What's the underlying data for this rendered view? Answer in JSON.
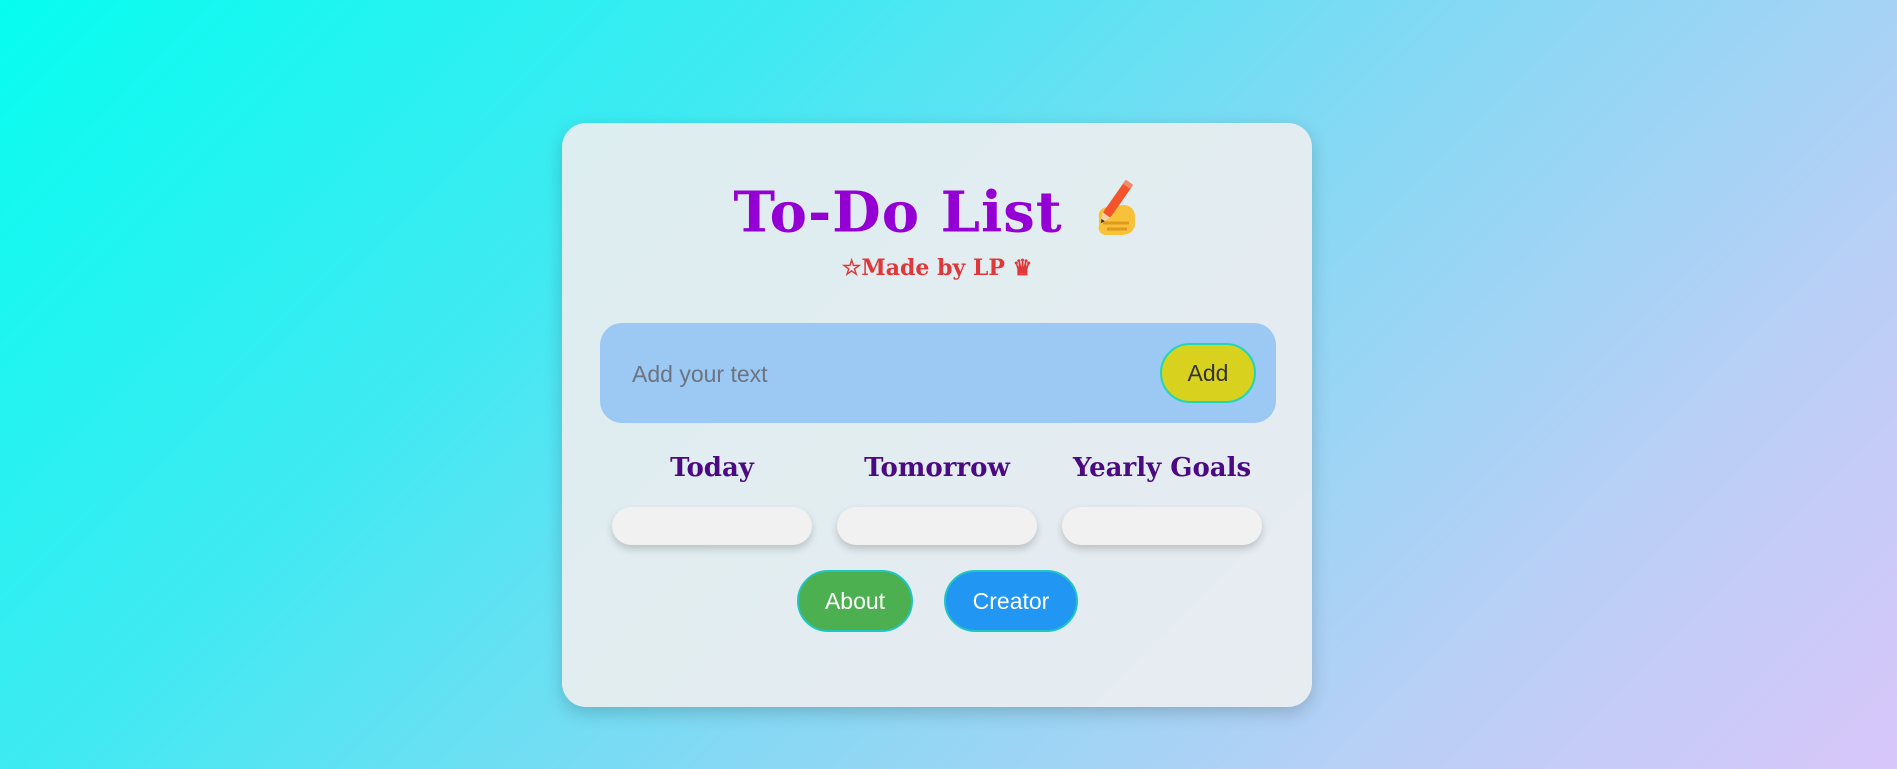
{
  "header": {
    "title": "To-Do List",
    "title_icon": "writing-hand-icon",
    "subtitle": "☆Made by LP ♛"
  },
  "input": {
    "placeholder": "Add your text",
    "value": "",
    "add_label": "Add"
  },
  "columns": [
    {
      "title": "Today",
      "items": []
    },
    {
      "title": "Tomorrow",
      "items": []
    },
    {
      "title": "Yearly Goals",
      "items": []
    }
  ],
  "footer": {
    "about_label": "About",
    "creator_label": "Creator"
  },
  "colors": {
    "title": "#9400d3",
    "subtitle": "#e0383a",
    "column_title": "#4b0a82",
    "input_bar": "#9cc8f4",
    "add_button": "#d8d21e",
    "about_button": "#4caf50",
    "creator_button": "#2196f3"
  }
}
